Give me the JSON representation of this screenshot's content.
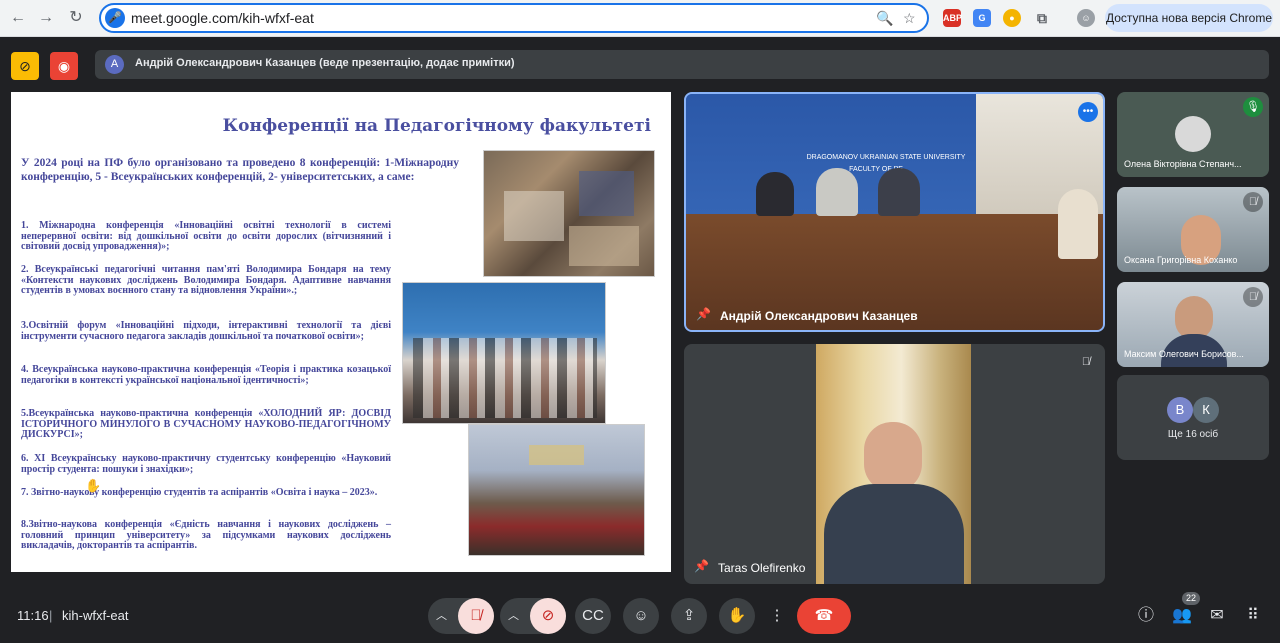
{
  "browser": {
    "url": "meet.google.com/kih-wfxf-eat",
    "update_label": "Доступна нова версія Chrome",
    "ext_abp": "ABP"
  },
  "meet": {
    "presenter_banner": "Андрій Олександрович Казанцев (веде презентацію, додає примітки)",
    "presenter_initial": "A"
  },
  "slide": {
    "title": "Конференції на Педагогічному факультеті",
    "intro": "У 2024 році на ПФ було організовано та проведено 8 конференцій: 1-Міжнародну конференцію, 5 - Всеукраїнських конференцій, 2- університетських, а саме:",
    "items": [
      "1. Міжнародна конференція «Інноваційні освітні технології в системі неперервної освіти: від дошкільної освіти до освіти дорослих (вітчизняний і світовий досвід упровадження)»;",
      "2. Всеукраїнські педагогічні читання пам'яті Володимира Бондаря на тему «Контексти наукових досліджень Володимира Бондаря. Адаптивне навчання студентів в умовах воєнного стану та відновлення України».;",
      "3.Освітній форум «Інноваційні підходи, інтерактивні технології та дієві інструменти сучасного педагога закладів дошкільної та початкової освіти»;",
      "4. Всеукраїнська науково-практична конференція «Теорія і практика козацької педагогіки в контексті української національної ідентичності»;",
      "5.Всеукраїнська науково-практична конференція «ХОЛОДНИЙ ЯР: ДОСВІД ІСТОРИЧНОГО МИНУЛОГО В СУЧАСНОМУ НАУКОВО-ПЕДАГОГІЧНОМУ ДИСКУРСІ»;",
      "6. XI Всеукраїнську науково-практичну студентську конференцію «Науковий простір студента: пошуки і знахідки»;",
      "7. Звітно-наукову конференцію студентів та аспірантів «Освіта і наука – 2023».",
      "8.Звітно-наукова конференція «Єдність навчання і наукових досліджень – головний принцип університету» за підсумками наукових досліджень викладачів, докторантів та аспірантів."
    ]
  },
  "tiles": {
    "main_speaker": "Андрій Олександрович Казанцев",
    "room_banner": "DRAGOMANOV UKRAINIAN STATE UNIVERSITY",
    "room_banner2": "FACULTY OF PE",
    "second_speaker": "Taras Olefirenko",
    "p1": "Олена Вікторівна Степанч...",
    "p2": "Оксана Григорівна Коханко",
    "p3": "Максим Олегович Борисов...",
    "others_label": "Ще 16 осіб",
    "others_a": "В",
    "others_b": "К"
  },
  "bottom": {
    "time": "11:16",
    "code": "kih-wfxf-eat",
    "people_count": "22"
  },
  "colors": {
    "accent_blue": "#1a73e8",
    "hangup": "#ea4335",
    "muted_bg": "#f9dedc"
  }
}
